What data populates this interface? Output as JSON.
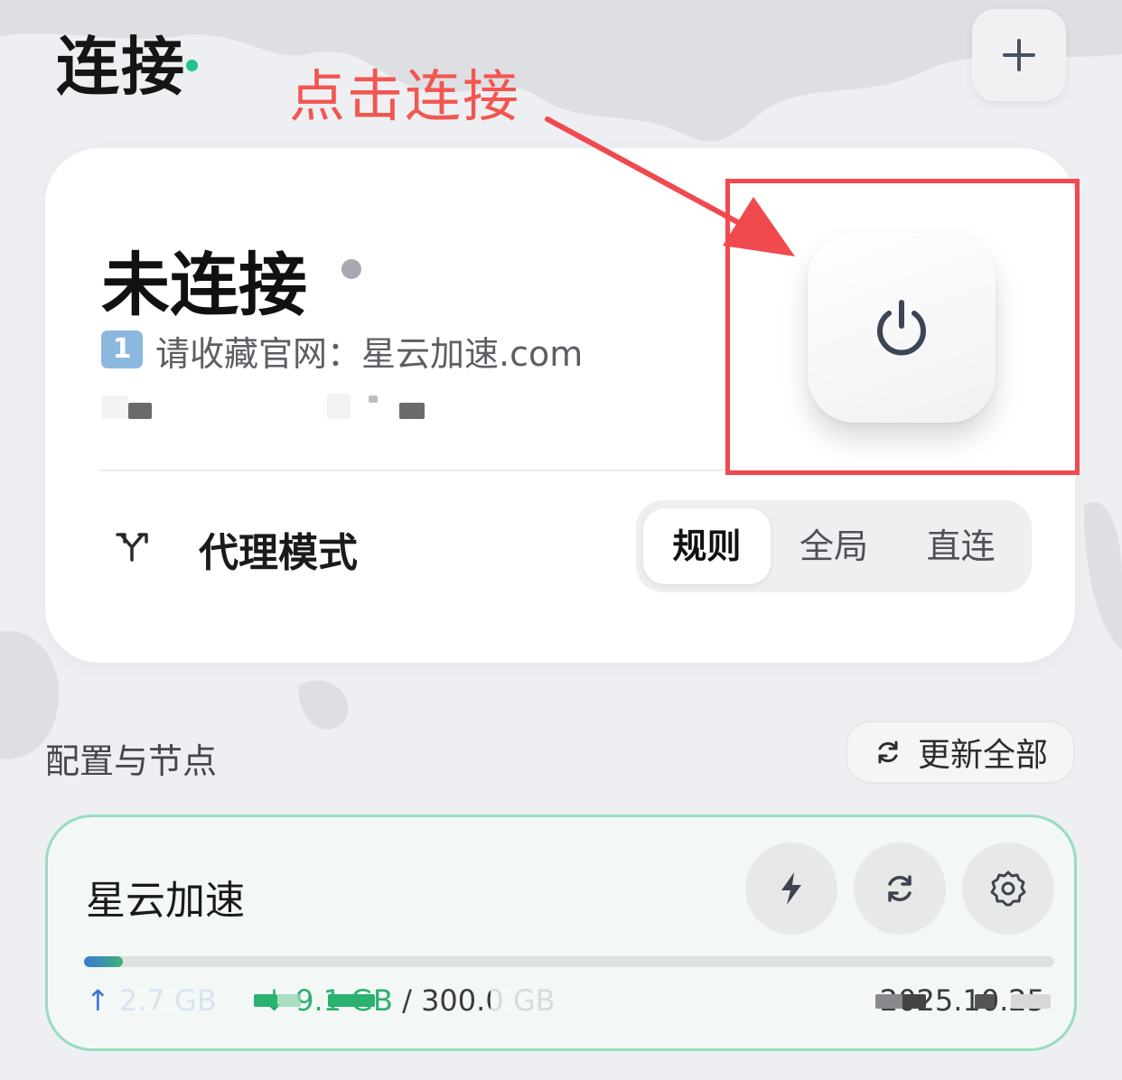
{
  "header": {
    "title": "连接",
    "add_label": "+"
  },
  "annotation": {
    "text": "点击连接",
    "color": "#f25650"
  },
  "status": {
    "state": "未连接",
    "notice_badge": "1",
    "notice_text": "请收藏官网：星云加速.com",
    "power_icon": "power-icon"
  },
  "proxy_mode": {
    "label": "代理模式",
    "options": [
      "规则",
      "全局",
      "直连"
    ],
    "selected": "规则"
  },
  "profiles": {
    "section_title": "配置与节点",
    "update_all_label": "更新全部",
    "items": [
      {
        "name": "星云加速",
        "upload": "↑ 2.7 GB",
        "download": "↓ 9.1 GB",
        "separator": " / ",
        "total": "300.0 GB",
        "expiry": "2025.10.25",
        "usage_fraction": 0.04,
        "actions": [
          "lightning-icon",
          "refresh-icon",
          "settings-icon"
        ]
      }
    ]
  },
  "colors": {
    "accent_green": "#1fc48b",
    "annotation_red": "#f0494e",
    "upload_blue": "#3f74d8",
    "download_green": "#2bb170"
  }
}
